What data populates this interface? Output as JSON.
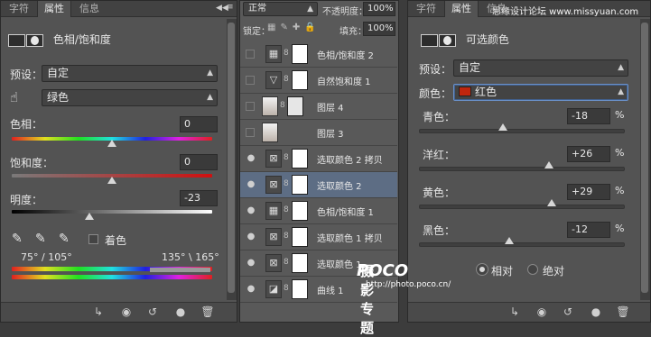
{
  "panel1": {
    "tabs": [
      "字符",
      "属性",
      "信息"
    ],
    "header": "色相/饱和度",
    "preset_label": "预设：",
    "preset_value": "自定",
    "channel_value": "绿色",
    "hue_label": "色相：",
    "hue_value": "0",
    "sat_label": "饱和度：",
    "sat_value": "0",
    "light_label": "明度：",
    "light_value": "-23",
    "colorize_label": "着色",
    "range_left": "75° / 105°",
    "range_right": "135° \\ 165°"
  },
  "panel2": {
    "blend_mode": "正常",
    "opacity_label": "不透明度：",
    "opacity_value": "100%",
    "lock_label": "锁定：",
    "fill_label": "填充：",
    "fill_value": "100%",
    "layers": [
      {
        "name": "色相/饱和度 2",
        "kind": "adj",
        "visible": false
      },
      {
        "name": "自然饱和度 1",
        "kind": "vibrance",
        "visible": false
      },
      {
        "name": "图层 4",
        "kind": "photo-mask",
        "visible": false
      },
      {
        "name": "图层 3",
        "kind": "photo",
        "visible": false
      },
      {
        "name": "选取颜色 2 拷贝",
        "kind": "sel",
        "visible": true
      },
      {
        "name": "选取颜色 2",
        "kind": "sel",
        "visible": true,
        "selected": true
      },
      {
        "name": "色相/饱和度 1",
        "kind": "adj",
        "visible": true
      },
      {
        "name": "选取颜色 1 拷贝",
        "kind": "sel",
        "visible": true
      },
      {
        "name": "选取颜色 1",
        "kind": "sel",
        "visible": true
      },
      {
        "name": "曲线 1",
        "kind": "curve",
        "visible": true
      }
    ]
  },
  "panel3": {
    "tabs": [
      "字符",
      "属性",
      "信息"
    ],
    "watermark_top": "思缘设计论坛 www.missyuan.com",
    "header": "可选颜色",
    "preset_label": "预设：",
    "preset_value": "自定",
    "color_label": "颜色：",
    "color_value": "红色",
    "color_swatch": "#c0260e",
    "sliders": [
      {
        "label": "青色：",
        "value": "-18",
        "pct": "%",
        "pos": 0.41
      },
      {
        "label": "洋红：",
        "value": "+26",
        "pct": "%",
        "pos": 0.63
      },
      {
        "label": "黄色：",
        "value": "+29",
        "pct": "%",
        "pos": 0.645
      },
      {
        "label": "黑色：",
        "value": "-12",
        "pct": "%",
        "pos": 0.44
      }
    ],
    "relative_label": "相对",
    "absolute_label": "绝对"
  },
  "watermark": {
    "poco": "POCO",
    "title": "摄影专题",
    "url": "http://photo.poco.cn/"
  }
}
